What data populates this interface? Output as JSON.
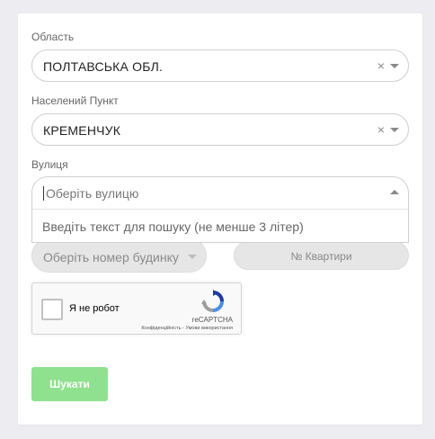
{
  "form": {
    "region": {
      "label": "Область",
      "value": "ПОЛТАВСЬКА ОБЛ.",
      "clear_symbol": "×"
    },
    "locality": {
      "label": "Населений Пункт",
      "value": "КРЕМЕНЧУК",
      "clear_symbol": "×"
    },
    "street": {
      "label": "Вулиця",
      "placeholder": "Оберіть вулицю",
      "dropdown_message": "Введіть текст для пошуку (не менше 3 літер)"
    },
    "house": {
      "placeholder": "Оберіть номер будинку"
    },
    "apartment": {
      "placeholder": "№ Квартири"
    },
    "recaptcha": {
      "label": "Я не робот",
      "brand": "reCAPTCHA",
      "terms": "Конфіденційність - Умови використання"
    },
    "submit_label": "Шукати"
  },
  "colors": {
    "page_background": "#ececf1",
    "submit_button": "#8fe08f",
    "disabled_field": "#e6e6e6"
  }
}
